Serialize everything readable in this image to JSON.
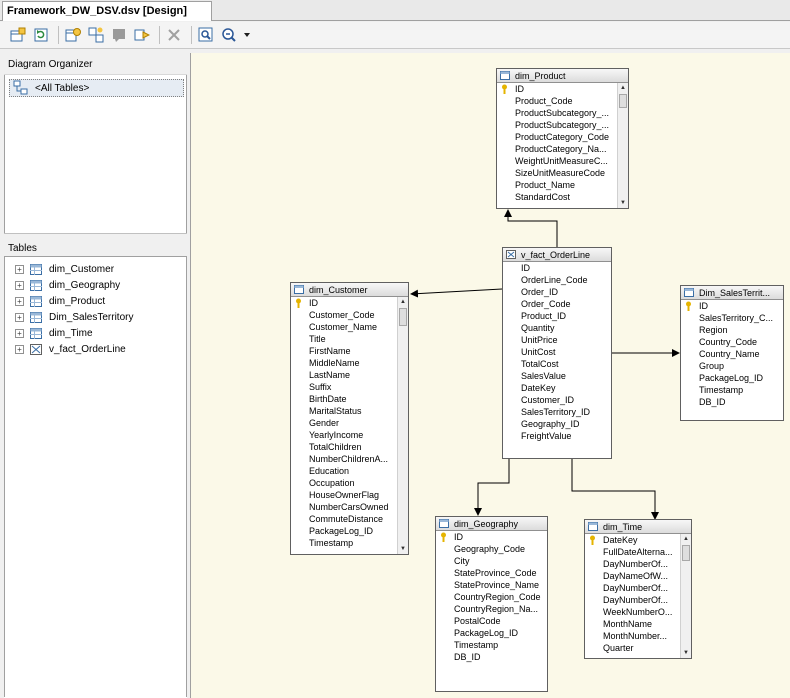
{
  "tab": {
    "title": "Framework_DW_DSV.dsv [Design]"
  },
  "toolbar": {
    "icons": [
      "add-remove-tables-icon",
      "refresh-icon",
      "new-named-query-icon",
      "new-relationship-icon",
      "new-diagram-icon",
      "replace-table-icon",
      "delete-icon",
      "find-table-icon",
      "zoom-icon",
      "dropdown-arrow-icon"
    ]
  },
  "organizer": {
    "header": "Diagram Organizer",
    "items": [
      {
        "label": "<All Tables>"
      }
    ]
  },
  "tables_pane": {
    "header": "Tables",
    "items": [
      {
        "label": "dim_Customer"
      },
      {
        "label": "dim_Geography"
      },
      {
        "label": "dim_Product"
      },
      {
        "label": "Dim_SalesTerritory"
      },
      {
        "label": "dim_Time"
      },
      {
        "label": "v_fact_OrderLine"
      }
    ]
  },
  "diagram": {
    "dim_product": {
      "title": "dim_Product",
      "columns": [
        "ID",
        "Product_Code",
        "ProductSubcategory_...",
        "ProductSubcategory_...",
        "ProductCategory_Code",
        "ProductCategory_Na...",
        "WeightUnitMeasureC...",
        "SizeUnitMeasureCode",
        "Product_Name",
        "StandardCost"
      ],
      "key_index": 0
    },
    "fact_orderline": {
      "title": "v_fact_OrderLine",
      "columns": [
        "ID",
        "OrderLine_Code",
        "Order_ID",
        "Order_Code",
        "Product_ID",
        "Quantity",
        "UnitPrice",
        "UnitCost",
        "TotalCost",
        "SalesValue",
        "DateKey",
        "Customer_ID",
        "SalesTerritory_ID",
        "Geography_ID",
        "FreightValue"
      ]
    },
    "dim_customer": {
      "title": "dim_Customer",
      "columns": [
        "ID",
        "Customer_Code",
        "Customer_Name",
        "Title",
        "FirstName",
        "MiddleName",
        "LastName",
        "Suffix",
        "BirthDate",
        "MaritalStatus",
        "Gender",
        "YearlyIncome",
        "TotalChildren",
        "NumberChildrenA...",
        "Education",
        "Occupation",
        "HouseOwnerFlag",
        "NumberCarsOwned",
        "CommuteDistance",
        "PackageLog_ID",
        "Timestamp"
      ],
      "key_index": 0
    },
    "dim_salesterritory": {
      "title": "Dim_SalesTerrit...",
      "columns": [
        "ID",
        "SalesTerritory_C...",
        "Region",
        "Country_Code",
        "Country_Name",
        "Group",
        "PackageLog_ID",
        "Timestamp",
        "DB_ID"
      ],
      "key_index": 0
    },
    "dim_geography": {
      "title": "dim_Geography",
      "columns": [
        "ID",
        "Geography_Code",
        "City",
        "StateProvince_Code",
        "StateProvince_Name",
        "CountryRegion_Code",
        "CountryRegion_Na...",
        "PostalCode",
        "PackageLog_ID",
        "Timestamp",
        "DB_ID"
      ],
      "key_index": 0
    },
    "dim_time": {
      "title": "dim_Time",
      "columns": [
        "DateKey",
        "FullDateAlterna...",
        "DayNumberOf...",
        "DayNameOfW...",
        "DayNumberOf...",
        "DayNumberOf...",
        "WeekNumberO...",
        "MonthName",
        "MonthNumber...",
        "Quarter"
      ],
      "key_index": 0
    }
  },
  "colors": {
    "canvas_bg": "#fbf9e8",
    "selection_bg": "#e6ecf3"
  }
}
